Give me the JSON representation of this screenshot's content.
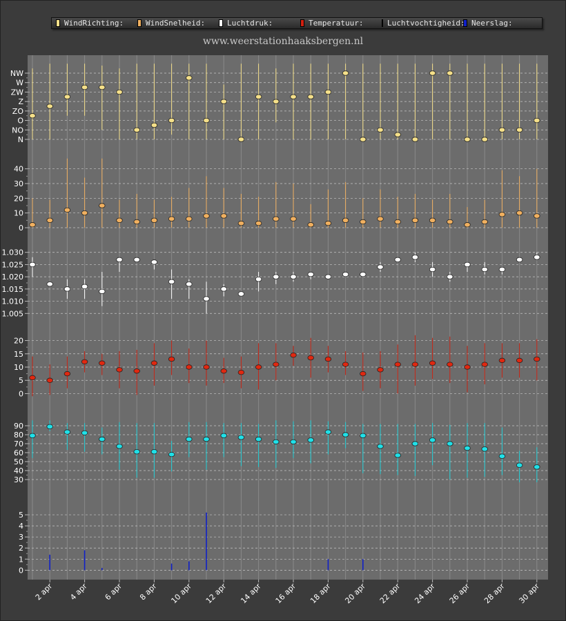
{
  "site": "www.weerstationhaaksbergen.nl",
  "legend": [
    {
      "label": "WindRichting:",
      "color": "#f5e08a"
    },
    {
      "label": "WindSnelheid:",
      "color": "#f0b060"
    },
    {
      "label": "Luchtdruk:",
      "color": "#ffffff"
    },
    {
      "label": "Temperatuur:",
      "color": "#d02010"
    },
    {
      "label": "Luchtvochtigheid:",
      "color": "#20d8e0"
    },
    {
      "label": "Neerslag:",
      "color": "#1020c8"
    }
  ],
  "chart_data": {
    "type": "scatter",
    "x_label_days": [
      2,
      4,
      6,
      8,
      10,
      12,
      14,
      16,
      18,
      20,
      22,
      24,
      26,
      28,
      30
    ],
    "x_label_suffix": " apr",
    "days": [
      1,
      2,
      3,
      4,
      5,
      6,
      7,
      8,
      9,
      10,
      11,
      12,
      13,
      14,
      15,
      16,
      17,
      18,
      19,
      20,
      21,
      22,
      23,
      24,
      25,
      26,
      27,
      28,
      29,
      30
    ],
    "panels": [
      {
        "name": "WindRichting",
        "color": "#f5e08a",
        "dot_color": "#f5e08a",
        "bar_color": "#f5e08a",
        "ylim": [
          0,
          7
        ],
        "ticks": [
          0,
          1,
          2,
          3,
          4,
          5,
          6,
          7
        ],
        "tick_labels": [
          "N",
          "NO",
          "O",
          "ZO",
          "Z",
          "ZW",
          "W",
          "NW"
        ],
        "values": [
          2.5,
          3.5,
          4.5,
          5.5,
          5.5,
          5,
          1,
          1.5,
          2,
          6.5,
          2,
          4,
          0,
          4.5,
          4,
          4.5,
          4.5,
          5,
          7,
          0,
          1,
          0.5,
          0,
          7,
          7,
          0,
          0,
          1,
          1,
          2
        ],
        "low": [
          0,
          0,
          2.5,
          2.5,
          1,
          0,
          0,
          0,
          0.5,
          0,
          0,
          0,
          0,
          0,
          1.8,
          0,
          0,
          0,
          0,
          0,
          0,
          0,
          0,
          0,
          0,
          0,
          0,
          0,
          0,
          0
        ],
        "high": [
          7.5,
          8,
          8,
          8,
          7.8,
          7.5,
          8,
          8,
          8,
          8,
          8,
          5.8,
          8,
          8,
          7.5,
          8,
          8,
          8,
          8,
          8,
          8,
          8,
          8,
          8,
          8,
          8,
          8,
          8,
          8,
          8
        ]
      },
      {
        "name": "WindSnelheid",
        "color": "#f0b060",
        "dot_color": "#f0b060",
        "bar_color": "#f0b060",
        "ylim": [
          0,
          45
        ],
        "ticks": [
          0,
          10,
          20,
          30,
          40
        ],
        "tick_labels": [
          "0",
          "10",
          "20",
          "30",
          "40"
        ],
        "values": [
          2,
          5,
          12,
          10,
          15,
          5,
          4,
          5,
          6,
          6,
          8,
          8,
          3,
          3,
          6,
          6,
          2,
          3,
          5,
          4,
          6,
          4,
          5,
          5,
          4,
          2,
          4,
          9,
          10,
          8
        ],
        "low": [
          0,
          0,
          0,
          0,
          0,
          0,
          0,
          0,
          0,
          0,
          0,
          0,
          0,
          0,
          0,
          0,
          0,
          0,
          0,
          0,
          0,
          0,
          0,
          0,
          0,
          0,
          0,
          0,
          0,
          0
        ],
        "high": [
          20,
          19,
          47,
          34,
          47,
          19,
          23,
          19,
          21,
          27,
          35,
          27,
          23,
          21,
          31,
          30,
          16,
          26,
          31,
          20,
          26,
          21,
          23,
          19,
          23,
          14,
          19,
          39,
          35,
          40
        ]
      },
      {
        "name": "Luchtdruk",
        "color": "#ffffff",
        "dot_color": "#ffffff",
        "bar_color": "#ffffff",
        "ylim": [
          1.0,
          1.035
        ],
        "ticks": [
          1.005,
          1.01,
          1.015,
          1.02,
          1.025,
          1.03
        ],
        "tick_labels": [
          "1.005",
          "1.010",
          "1.015",
          "1.020",
          "1.025",
          "1.030"
        ],
        "values": [
          1.025,
          1.017,
          1.015,
          1.016,
          1.014,
          1.027,
          1.027,
          1.026,
          1.018,
          1.017,
          1.011,
          1.015,
          1.013,
          1.019,
          1.02,
          1.02,
          1.021,
          1.02,
          1.021,
          1.021,
          1.024,
          1.027,
          1.028,
          1.023,
          1.02,
          1.025,
          1.023,
          1.023,
          1.027,
          1.028
        ],
        "low": [
          1.02,
          1.016,
          1.011,
          1.011,
          1.008,
          1.022,
          1.026,
          1.023,
          1.011,
          1.011,
          1.005,
          1.012,
          1.013,
          1.014,
          1.017,
          1.018,
          1.019,
          1.02,
          1.02,
          1.02,
          1.022,
          1.026,
          1.026,
          1.02,
          1.018,
          1.022,
          1.021,
          1.021,
          1.026,
          1.027
        ],
        "high": [
          1.028,
          1.018,
          1.019,
          1.019,
          1.022,
          1.028,
          1.028,
          1.027,
          1.023,
          1.019,
          1.018,
          1.017,
          1.014,
          1.022,
          1.022,
          1.022,
          1.022,
          1.021,
          1.021,
          1.022,
          1.026,
          1.028,
          1.03,
          1.026,
          1.022,
          1.026,
          1.026,
          1.024,
          1.028,
          1.03
        ]
      },
      {
        "name": "Temperatuur",
        "color": "#d02010",
        "dot_color": "#e02810",
        "bar_color": "#c82010",
        "ylim": [
          -3,
          23
        ],
        "ticks": [
          0,
          5,
          10,
          15,
          20
        ],
        "tick_labels": [
          "0",
          "5",
          "10",
          "15",
          "20"
        ],
        "values": [
          6,
          5,
          7.5,
          12,
          11.5,
          9,
          8.5,
          11.5,
          13,
          10,
          10,
          8.5,
          8,
          10,
          11,
          14.5,
          13.5,
          13,
          11,
          7.5,
          9,
          11,
          11,
          11.5,
          11,
          10,
          11,
          12.5,
          12.5,
          13
        ],
        "low": [
          -1,
          -0.5,
          2,
          8,
          7,
          2,
          -0.5,
          3,
          7,
          4,
          3,
          4,
          2,
          1.5,
          5,
          10.5,
          6,
          8,
          7,
          1,
          2,
          0,
          3,
          5.5,
          4,
          0.5,
          3.5,
          6,
          6,
          5
        ],
        "high": [
          14,
          11,
          14,
          16,
          15,
          16,
          16.5,
          19,
          20,
          17,
          20,
          13.5,
          14,
          19,
          19,
          18,
          21,
          18,
          16,
          15.5,
          16,
          18.5,
          22,
          21,
          21.5,
          18,
          19,
          19,
          19,
          20.5
        ]
      },
      {
        "name": "Luchtvochtigheid",
        "color": "#20d8e0",
        "dot_color": "#20e0e8",
        "bar_color": "#20d0d8",
        "ylim": [
          20,
          100
        ],
        "ticks": [
          30,
          40,
          50,
          60,
          70,
          80,
          90
        ],
        "tick_labels": [
          "30",
          "40",
          "50",
          "60",
          "70",
          "80",
          "90"
        ],
        "values": [
          79,
          89,
          83,
          82,
          75,
          67,
          61,
          61,
          58,
          75,
          75,
          79,
          77,
          75,
          72,
          72,
          74,
          83,
          80,
          79,
          67,
          57,
          70,
          74,
          70,
          65,
          64,
          56,
          46,
          44
        ],
        "low": [
          54,
          84,
          63,
          61,
          58,
          41,
          32,
          32,
          39,
          55,
          41,
          55,
          45,
          44,
          43,
          54,
          48,
          58,
          65,
          37,
          36,
          35,
          34,
          46,
          30,
          32,
          33,
          35,
          27,
          27
        ],
        "high": [
          96,
          96,
          93,
          93,
          88,
          94,
          93,
          93,
          73,
          94,
          94,
          93,
          93,
          92,
          96,
          95,
          96,
          95,
          94,
          92,
          92,
          92,
          92,
          93,
          91,
          93,
          93,
          88,
          62,
          66
        ]
      },
      {
        "name": "Neerslag",
        "color": "#1020c8",
        "bar_color": "#1020c8",
        "ylim": [
          -0.6,
          6
        ],
        "ticks": [
          0,
          1,
          2,
          3,
          4,
          5
        ],
        "tick_labels": [
          "0",
          "1",
          "2",
          "3",
          "4",
          "5"
        ],
        "values": [
          0,
          1.4,
          0,
          1.8,
          0.2,
          0,
          0,
          0,
          0.6,
          0.8,
          5.2,
          0,
          0,
          0,
          0,
          0,
          0,
          1,
          0,
          1,
          0,
          0,
          0,
          0,
          0,
          0,
          0,
          0,
          0,
          0
        ]
      }
    ]
  }
}
